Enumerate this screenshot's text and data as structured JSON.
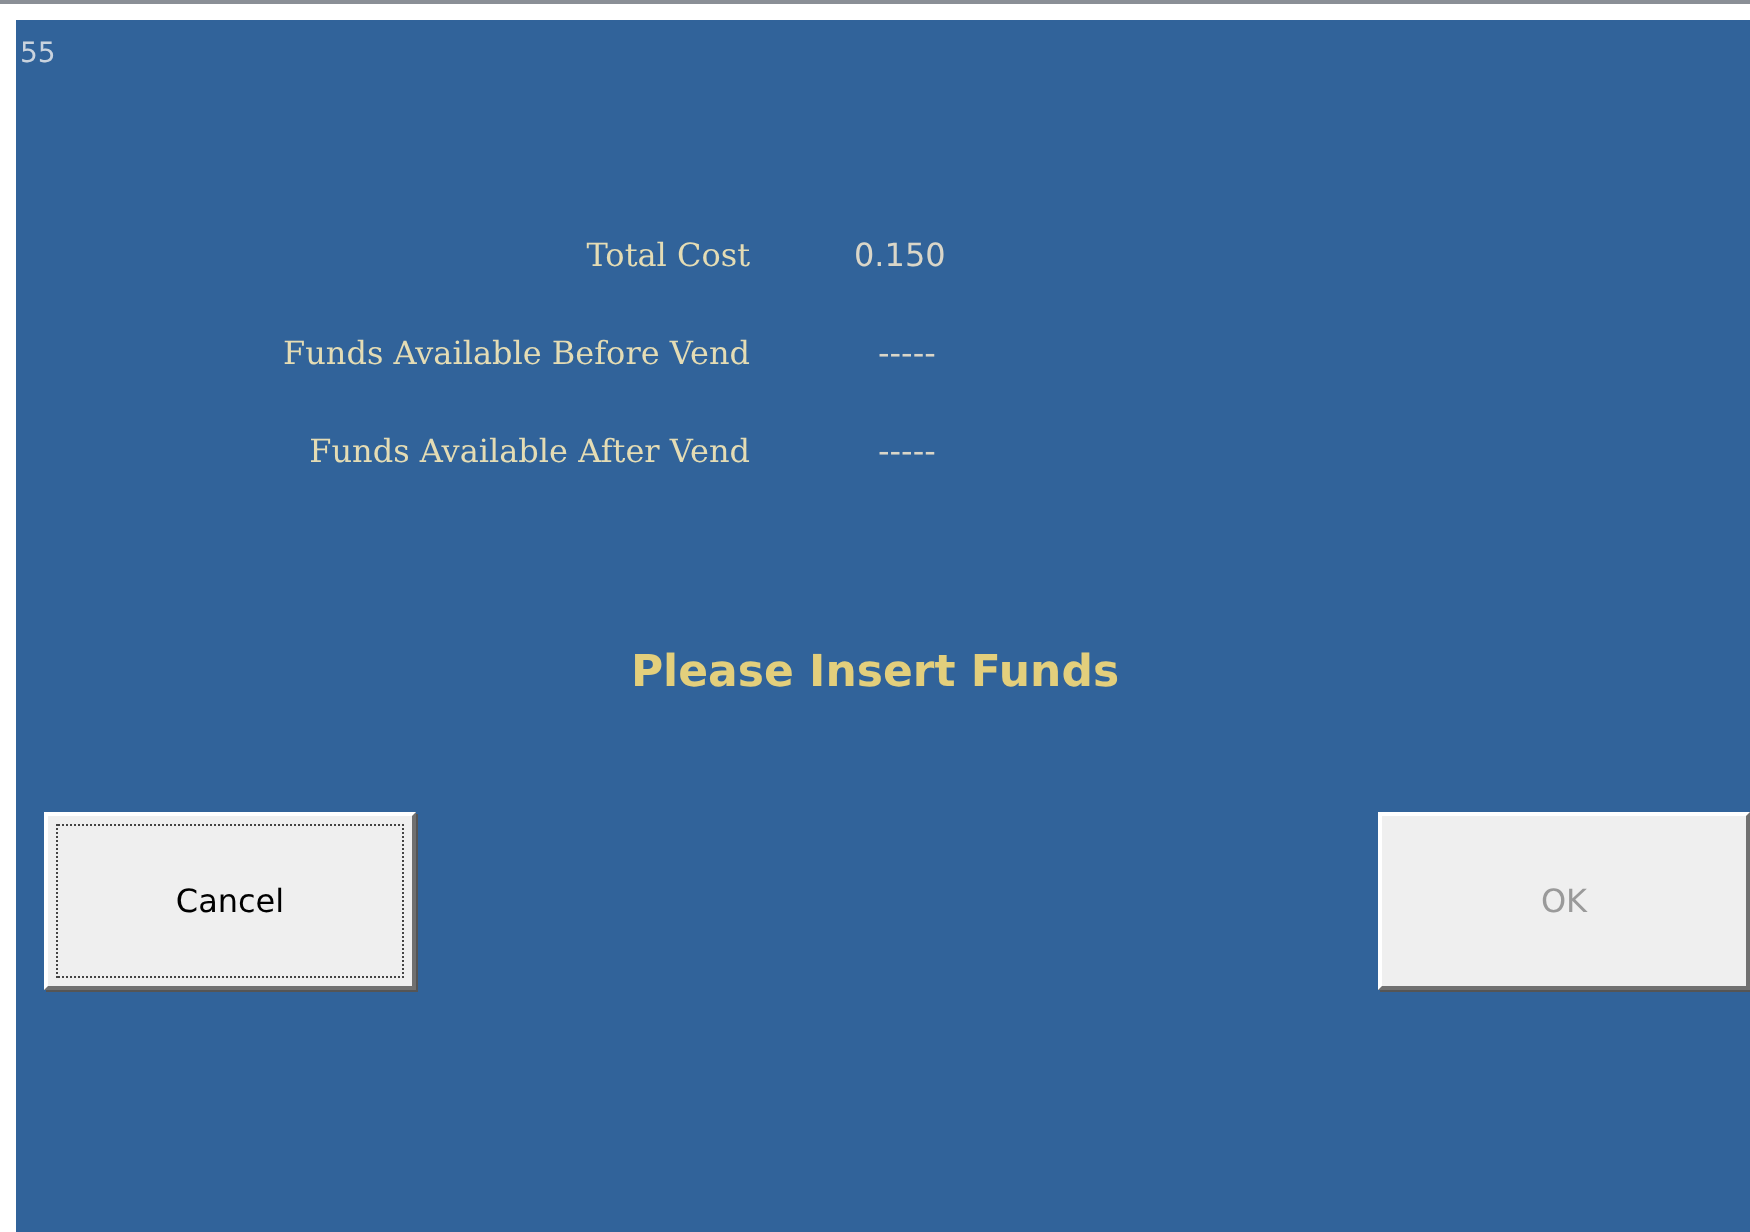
{
  "screen_number": "55",
  "summary": [
    {
      "label": "Total Cost",
      "value": "0.150"
    },
    {
      "label": "Funds Available Before Vend",
      "value": "-----"
    },
    {
      "label": "Funds Available After Vend",
      "value": "-----"
    }
  ],
  "message": "Please Insert Funds",
  "buttons": [
    {
      "label": "Cancel",
      "disabled": false,
      "focused": true
    },
    {
      "label": "OK",
      "disabled": true,
      "focused": false
    }
  ]
}
